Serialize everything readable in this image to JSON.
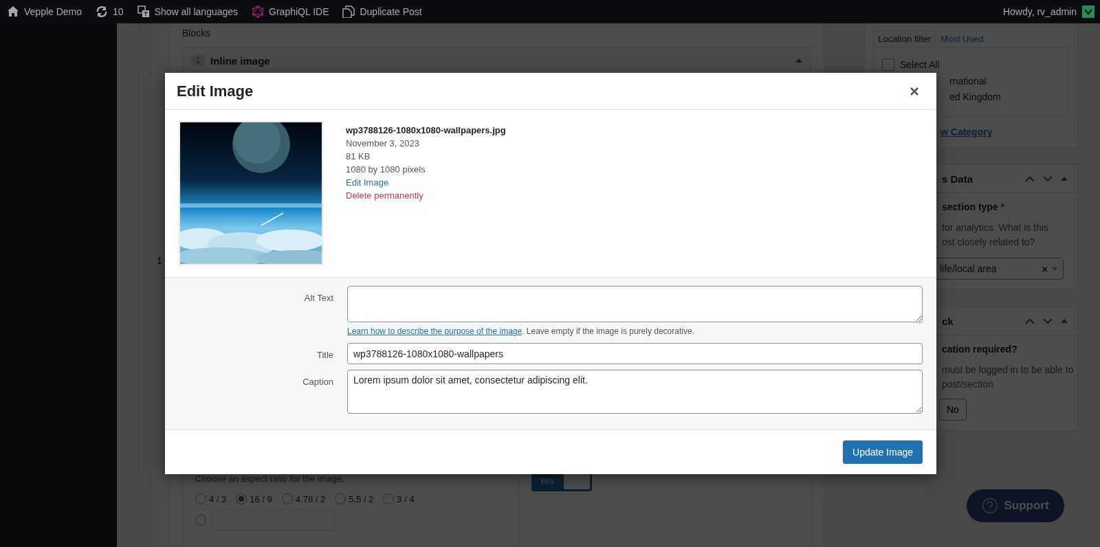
{
  "admin_bar": {
    "items": [
      {
        "kind": "home",
        "label": "Vepple Demo"
      },
      {
        "kind": "updates",
        "label": "10"
      },
      {
        "kind": "translate",
        "label": "Show all languages"
      },
      {
        "kind": "graphql",
        "label": "GraphiQL IDE"
      },
      {
        "kind": "duplicate",
        "label": "Duplicate Post"
      }
    ],
    "account": "Howdy, rv_admin"
  },
  "editor": {
    "blocks_label": "Blocks",
    "block": {
      "number": "1",
      "title": "Inline image"
    },
    "row_number": "1",
    "aspect_ratio": {
      "description": "Choose an aspect ratio for the image.",
      "options": [
        {
          "label": "4 / 3",
          "selected": false
        },
        {
          "label": "16 / 9",
          "selected": true
        },
        {
          "label": "4.78 / 2",
          "selected": false
        },
        {
          "label": "5.5 / 2",
          "selected": false
        },
        {
          "label": "3 / 4",
          "selected": false
        }
      ],
      "custom_selected": false
    },
    "toggle": {
      "label": "Yes",
      "on": true
    }
  },
  "sidebar": {
    "tabs": [
      {
        "label": "Location filter",
        "selected": true
      },
      {
        "label": "Most Used",
        "selected": false
      }
    ],
    "checklist": [
      {
        "label": "Select All",
        "kind": "checkbox",
        "checked": false
      },
      {
        "label": "rnational",
        "kind": "clipped"
      },
      {
        "label": "ed Kingdom",
        "kind": "clipped"
      }
    ],
    "add_link": "w Category",
    "panels": [
      {
        "title": "s Data",
        "kind": "select",
        "field_label": "section type",
        "required": "*",
        "help": [
          "for analytics. What is this",
          "ost closely related to?"
        ],
        "value": "life/local area",
        "clear": "×"
      },
      {
        "title": "ck",
        "kind": "buttons",
        "field_label": "cation required?",
        "help": [
          "must be logged in to be able to",
          "post/section"
        ],
        "button": "No"
      }
    ]
  },
  "support_button": "Support",
  "modal": {
    "title": "Edit Image",
    "details": {
      "filename": "wp3788126-1080x1080-wallpapers.jpg",
      "date": "November 3, 2023",
      "size": "81 KB",
      "dimensions": "1080 by 1080 pixels",
      "edit_link": "Edit Image",
      "delete_link": "Delete permanently"
    },
    "fields": [
      {
        "label": "Alt Text",
        "kind": "textarea",
        "help_link": "Learn how to describe the purpose of the image",
        "help": ". Leave empty if the image is purely decorative."
      },
      {
        "label": "Title",
        "kind": "input",
        "value": "wp3788126-1080x1080-wallpapers"
      },
      {
        "label": "Caption",
        "kind": "textarea",
        "value": "Lorem ipsum dolor sit amet, consectetur adipiscing elit."
      }
    ],
    "primary_button": "Update Image"
  }
}
